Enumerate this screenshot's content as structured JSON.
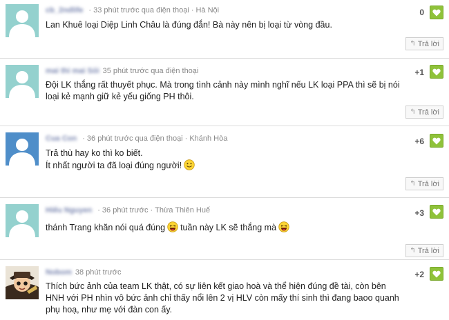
{
  "reply_label": "Trả lời",
  "colors": {
    "like_green": "#8fc23a",
    "avatar_teal": "#94d1ce",
    "avatar_blue": "#4f8ec9"
  },
  "comments": [
    {
      "username": "cb_2ndlife",
      "time": "33 phút trước qua điện thoại",
      "location": "Hà Nội",
      "text": "Lan Khuê loại Diệp Linh Châu là đúng đắn! Bà này nên bị loại từ vòng đầu.",
      "likes": "0",
      "avatar": "default-teal"
    },
    {
      "username": "mai thi mai Sỏi",
      "time": "35 phút trước qua điện thoại",
      "location": "",
      "text": "Đội LK thắng rất thuyết phục. Mà trong tình cảnh này mình nghĩ nếu LK loại PPA thì sẽ bị nói loại kẻ mạnh giữ kẻ yếu giống PH thôi.",
      "likes": "+1",
      "avatar": "default-teal"
    },
    {
      "username": "Cua Con",
      "time": "36 phút trước qua điện thoại",
      "location": "Khánh Hòa",
      "text_line1": "Trả thù hay ko thì ko biết.",
      "text_line2": "Ít nhất người ta đã loại đúng người!",
      "likes": "+6",
      "avatar": "default-blue",
      "emoji": "smile"
    },
    {
      "username": "Hiếu Nguyen",
      "time": "36 phút trước",
      "location": "Thừa Thiên Huế",
      "text_part1": "thánh Trang khăn nói quá đúng",
      "text_part2": "tuần này LK sẽ thắng mà",
      "likes": "+3",
      "avatar": "default-teal",
      "emoji": "laugh"
    },
    {
      "username": "Nobom",
      "time": "38 phút trước",
      "location": "",
      "text": "Thích bức ảnh của team LK thật, có sự liên kết giao hoà và thể hiện đúng đề tài, còn bên HNH với PH nhìn vô bức ảnh chỉ thấy nổi lên 2 vị HLV còn mấy thí sinh thì đang baoo quanh phụ hoạ, như mẹ với đàn con ấy.",
      "likes": "+2",
      "avatar": "photo"
    }
  ]
}
